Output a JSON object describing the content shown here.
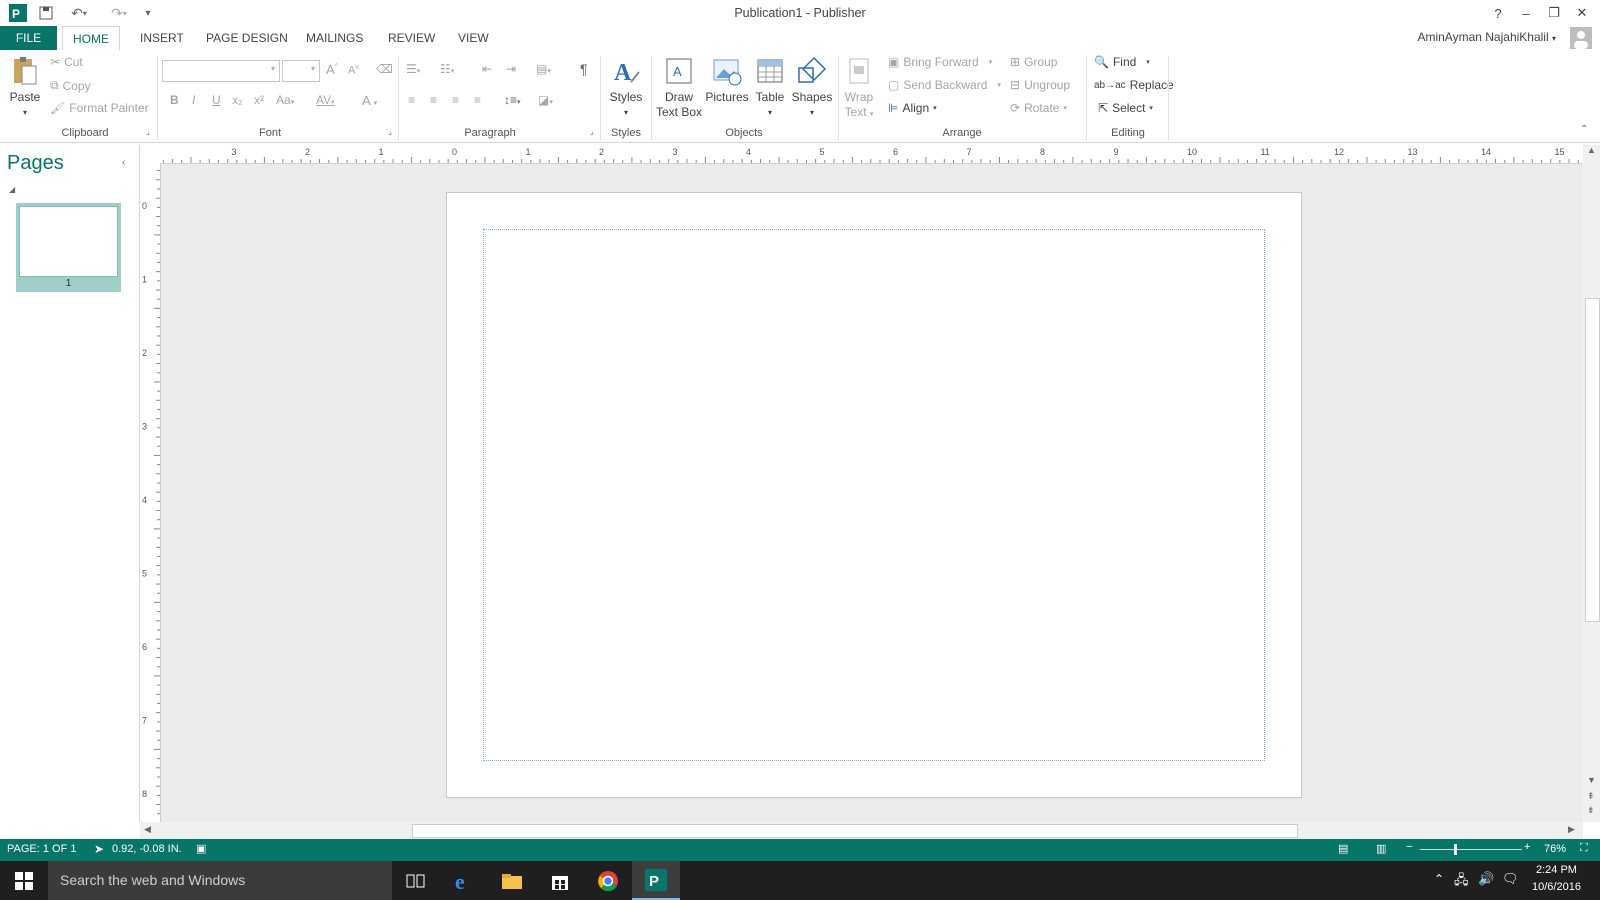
{
  "window": {
    "title": "Publication1 - Publisher"
  },
  "qat": {
    "icons": [
      "publisher-logo-icon",
      "save-icon",
      "undo-icon",
      "redo-icon",
      "customize-icon"
    ]
  },
  "window_controls": {
    "help": "?",
    "minimize": "–",
    "restore": "❐",
    "close": "✕"
  },
  "tabs": [
    {
      "label": "FILE"
    },
    {
      "label": "HOME"
    },
    {
      "label": "INSERT"
    },
    {
      "label": "PAGE DESIGN"
    },
    {
      "label": "MAILINGS"
    },
    {
      "label": "REVIEW"
    },
    {
      "label": "VIEW"
    }
  ],
  "user": {
    "name": "AminAyman NajahiKhalil"
  },
  "ribbon": {
    "clipboard": {
      "label": "Clipboard",
      "paste": "Paste",
      "cut": "Cut",
      "copy": "Copy",
      "format_painter": "Format Painter"
    },
    "font": {
      "label": "Font",
      "bold": "B",
      "italic": "I",
      "underline": "U",
      "subscript": "x₂",
      "superscript": "x²",
      "change_case": "Aa",
      "font_color": "A",
      "char_spacing": "AV",
      "grow": "A",
      "shrink": "A"
    },
    "paragraph": {
      "label": "Paragraph",
      "pilcrow": "¶"
    },
    "styles": {
      "label": "Styles",
      "button": "Styles"
    },
    "objects": {
      "label": "Objects",
      "draw_text_box_1": "Draw",
      "draw_text_box_2": "Text Box",
      "pictures": "Pictures",
      "table": "Table",
      "shapes": "Shapes"
    },
    "arrange": {
      "label": "Arrange",
      "wrap_text_1": "Wrap",
      "wrap_text_2": "Text",
      "bring_forward": "Bring Forward",
      "send_backward": "Send Backward",
      "align": "Align",
      "group": "Group",
      "ungroup": "Ungroup",
      "rotate": "Rotate"
    },
    "editing": {
      "label": "Editing",
      "find": "Find",
      "replace": "Replace",
      "select": "Select"
    }
  },
  "pages_panel": {
    "title": "Pages",
    "thumb_number": "1"
  },
  "ruler": {
    "h_labels": [
      "3",
      "2",
      "1",
      "0",
      "1",
      "2",
      "3",
      "4",
      "5",
      "6",
      "7",
      "8",
      "9",
      "10",
      "11",
      "12",
      "13",
      "14",
      "15"
    ],
    "v_labels": [
      "0",
      "1",
      "2",
      "3",
      "4",
      "5",
      "6",
      "7",
      "8"
    ]
  },
  "status": {
    "page": "PAGE: 1 OF 1",
    "position": "0.92, -0.08 IN.",
    "zoom": "76%"
  },
  "taskbar": {
    "search_placeholder": "Search the web and Windows",
    "time": "2:24 PM",
    "date": "10/6/2016"
  }
}
